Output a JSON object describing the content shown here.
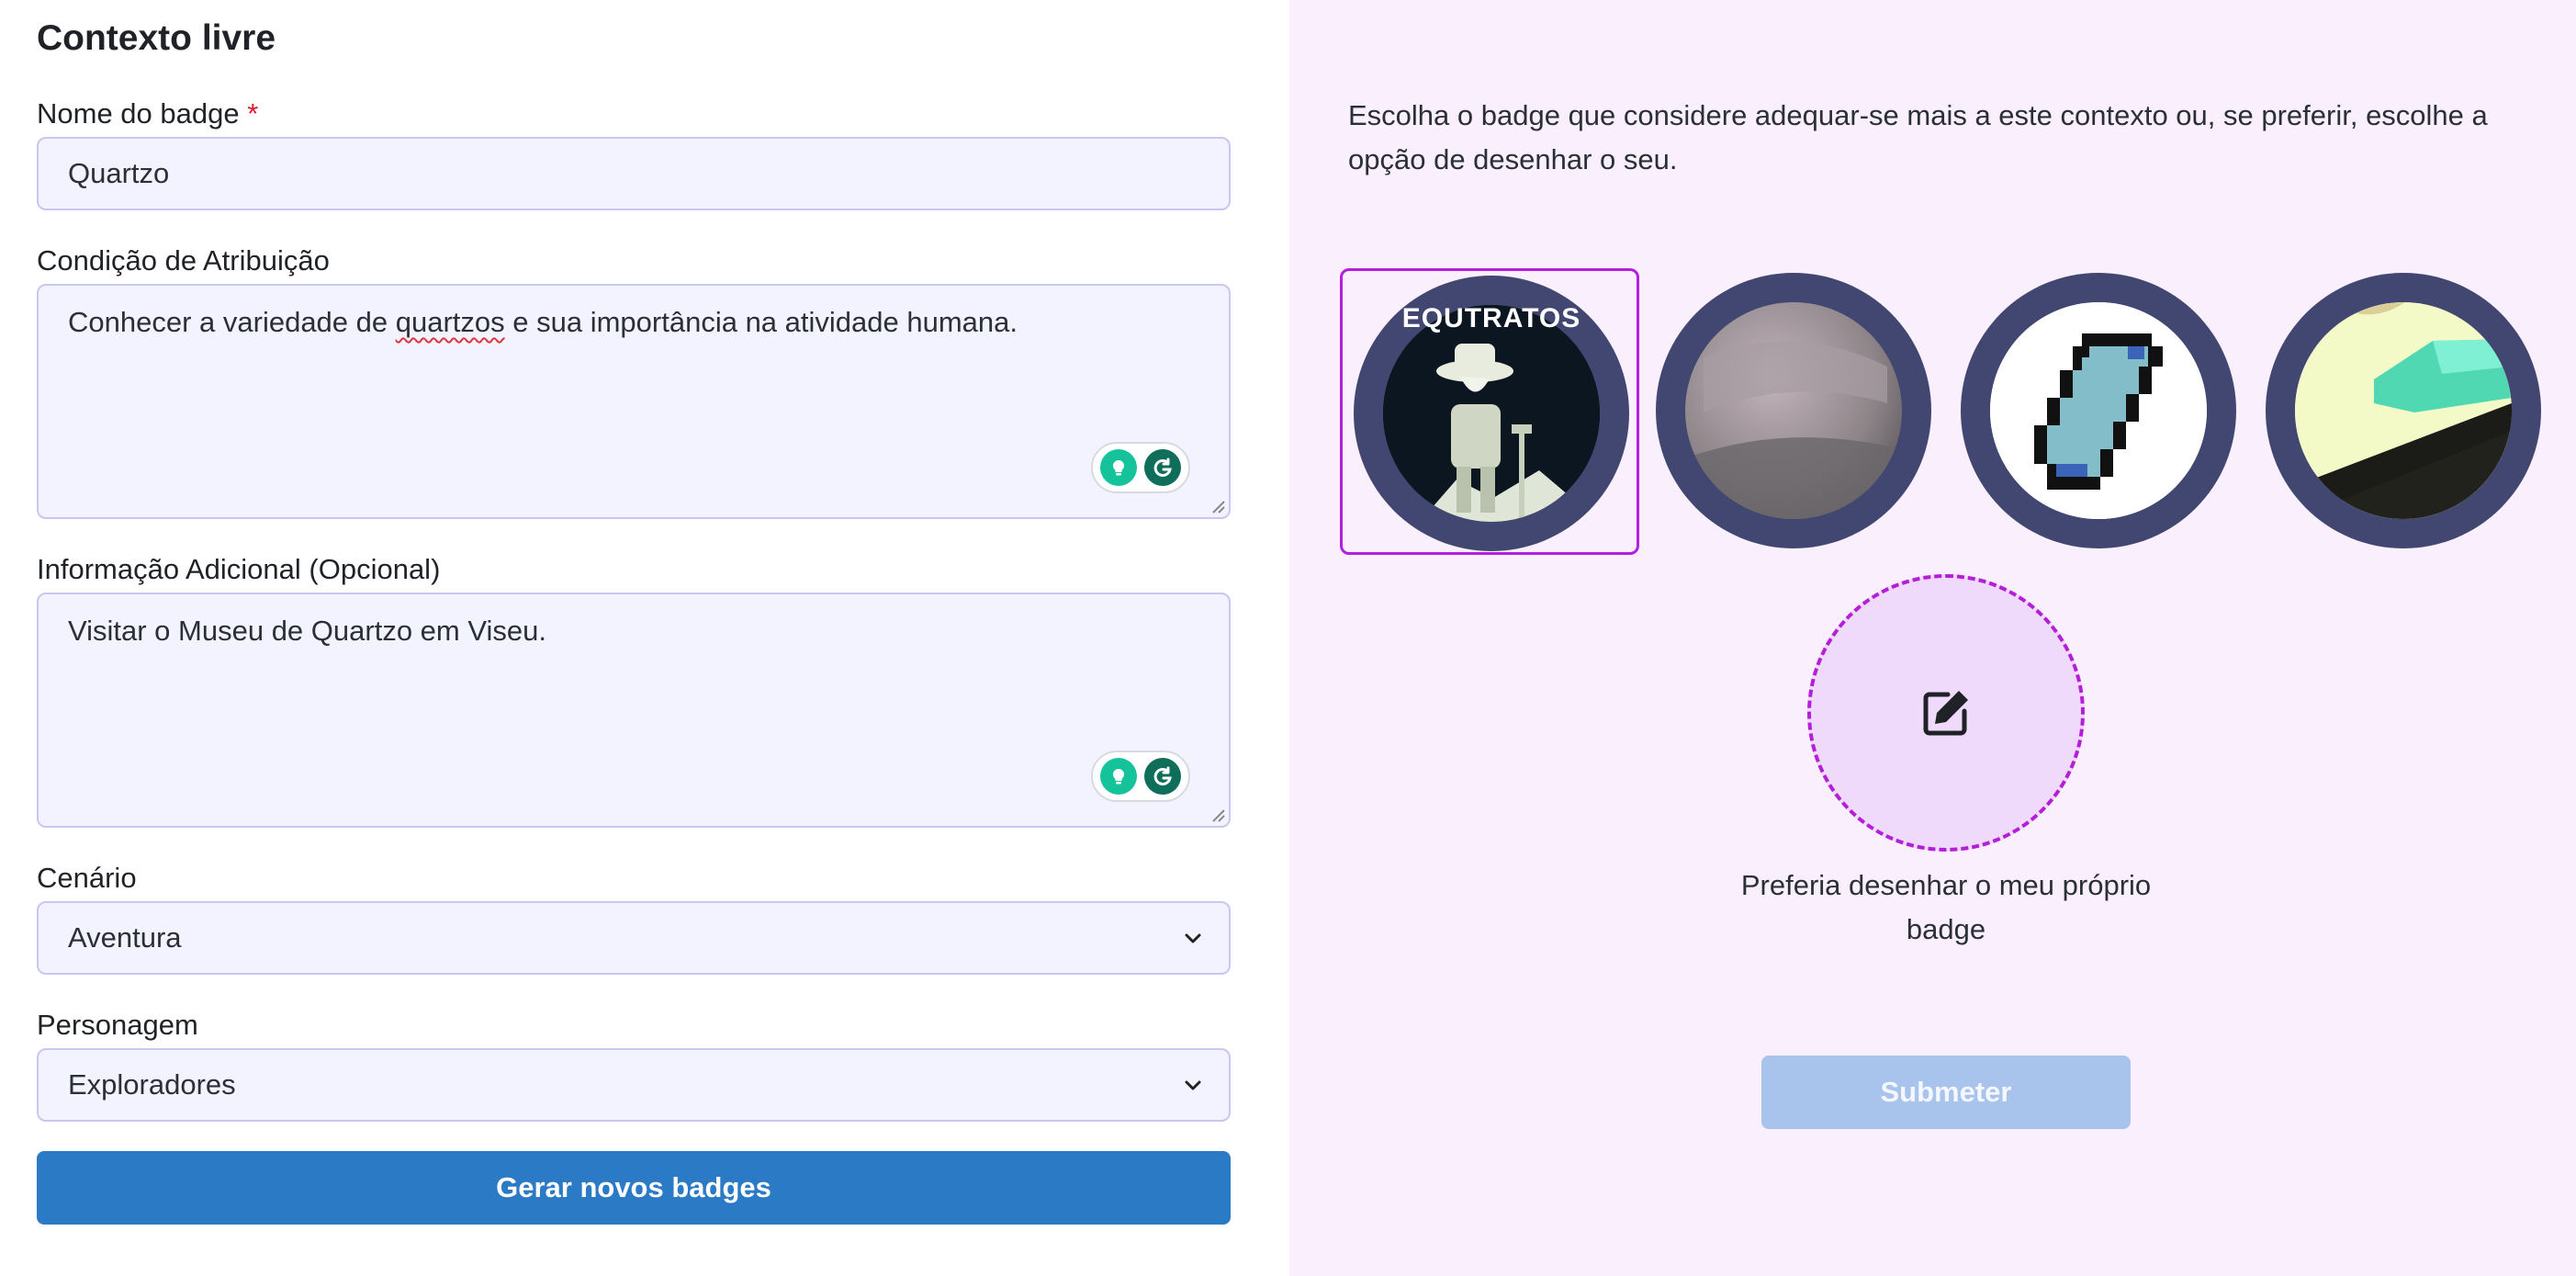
{
  "form": {
    "title": "Contexto livre",
    "name_label": "Nome do badge",
    "required_mark": "*",
    "name_value": "Quartzo",
    "condition_label": "Condição de Atribuição",
    "condition_before": "Conhecer a variedade de ",
    "condition_misspelled": "quartzos",
    "condition_after": " e sua importância na atividade humana.",
    "extra_label": "Informação Adicional (Opcional)",
    "extra_value": "Visitar o Museu de Quartzo em Viseu.",
    "scenario_label": "Cenário",
    "scenario_value": "Aventura",
    "character_label": "Personagem",
    "character_value": "Exploradores",
    "generate_button": "Gerar novos badges"
  },
  "badges": {
    "instructions": "Escolha o badge que considere adequar-se mais a este contexto ou, se preferir, escolhe a opção de desenhar o seu.",
    "items": [
      {
        "name": "explorer-badge",
        "text": "EQUTRATOS",
        "selected": true
      },
      {
        "name": "grey-stone-badge",
        "selected": false
      },
      {
        "name": "pixel-crystal-badge",
        "selected": false
      },
      {
        "name": "green-crystal-badge",
        "selected": false
      }
    ],
    "draw_option_text": "Preferia desenhar o meu próprio badge",
    "draw_icon": "edit-square-icon",
    "submit_button": "Submeter"
  },
  "colors": {
    "accent_purple": "#b31ee0",
    "primary_blue": "#2b7ac6",
    "disabled_blue": "#a8c3ec",
    "badge_ring": "#414770",
    "panel_bg": "#faf0fd"
  }
}
